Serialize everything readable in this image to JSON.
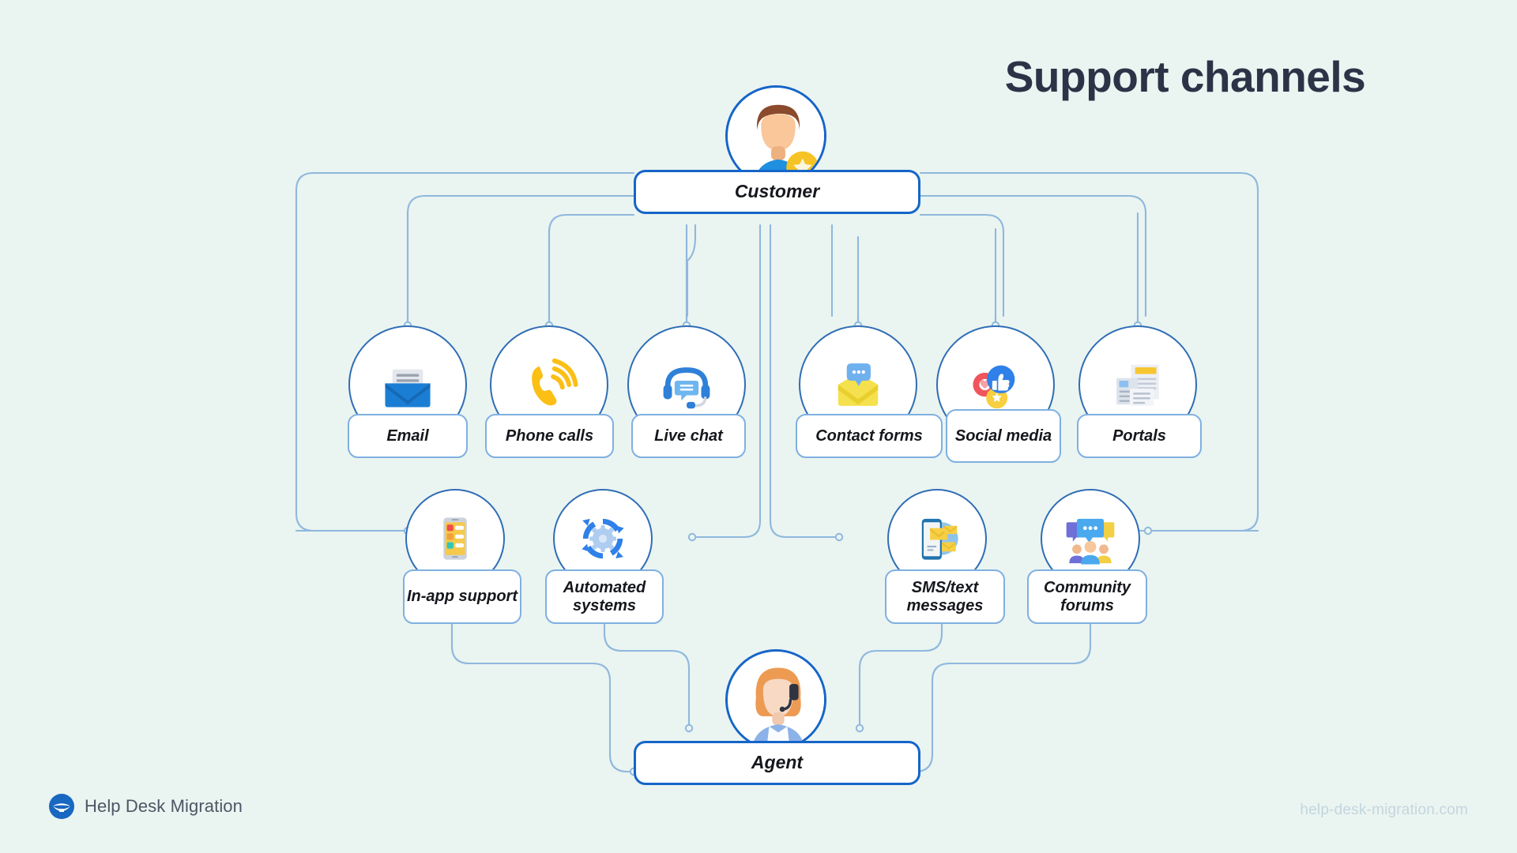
{
  "page": {
    "title": "Support channels",
    "background_color": "#eaf4f1",
    "accent_color": "#1565c8",
    "line_color": "#7fb0e0",
    "title_color": "#2b3447"
  },
  "diagram": {
    "type": "hierarchy-flow",
    "top_node": {
      "label": "Customer",
      "avatar": "customer-avatar-icon"
    },
    "bottom_node": {
      "label": "Agent",
      "avatar": "agent-headset-avatar-icon"
    },
    "channels_row_1": [
      {
        "label": "Email",
        "icon": "email-envelope-icon"
      },
      {
        "label": "Phone calls",
        "icon": "phone-call-icon"
      },
      {
        "label": "Live chat",
        "icon": "headset-chat-icon"
      },
      {
        "label": "Contact forms",
        "icon": "contact-form-envelope-icon"
      },
      {
        "label": "Social media",
        "icon": "social-media-icon"
      },
      {
        "label": "Portals",
        "icon": "portal-documents-icon"
      }
    ],
    "channels_row_2": [
      {
        "label": "In-app support",
        "icon": "mobile-app-icon"
      },
      {
        "label": "Automated systems",
        "icon": "automation-gear-icon"
      },
      {
        "label": "SMS/text messages",
        "icon": "sms-phone-icon"
      },
      {
        "label": "Community forums",
        "icon": "community-forum-icon"
      }
    ]
  },
  "footer": {
    "brand": "Help Desk Migration",
    "brand_icon": "help-desk-migration-logo",
    "url": "help-desk-migration.com"
  }
}
